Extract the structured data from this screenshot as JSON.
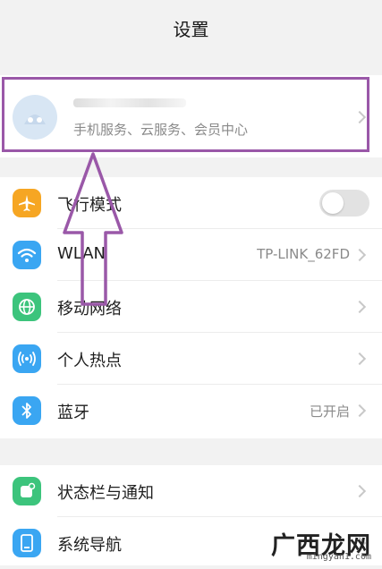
{
  "header": {
    "title": "设置"
  },
  "account": {
    "name": "",
    "subtitle": "手机服务、云服务、会员中心"
  },
  "section1": [
    {
      "id": "airplane",
      "label": "飞行模式",
      "icon": "airplane-icon",
      "icon_color": "#f6a623",
      "control": "toggle",
      "toggle_on": false
    },
    {
      "id": "wlan",
      "label": "WLAN",
      "icon": "wifi-icon",
      "icon_color": "#3aa6f2",
      "value": "TP-LINK_62FD"
    },
    {
      "id": "mobile-network",
      "label": "移动网络",
      "icon": "globe-icon",
      "icon_color": "#3cc47c"
    },
    {
      "id": "hotspot",
      "label": "个人热点",
      "icon": "hotspot-icon",
      "icon_color": "#3aa6f2"
    },
    {
      "id": "bluetooth",
      "label": "蓝牙",
      "icon": "bluetooth-icon",
      "icon_color": "#3aa6f2",
      "value": "已开启"
    }
  ],
  "section2": [
    {
      "id": "statusbar",
      "label": "状态栏与通知",
      "icon": "notification-icon",
      "icon_color": "#3cc47c"
    },
    {
      "id": "navigation",
      "label": "系统导航",
      "icon": "navigation-icon",
      "icon_color": "#3aa6f2"
    }
  ],
  "annotation": {
    "color": "#9a58a8"
  },
  "watermark": {
    "text": "广西龙网",
    "url": "mingyan1.com"
  }
}
